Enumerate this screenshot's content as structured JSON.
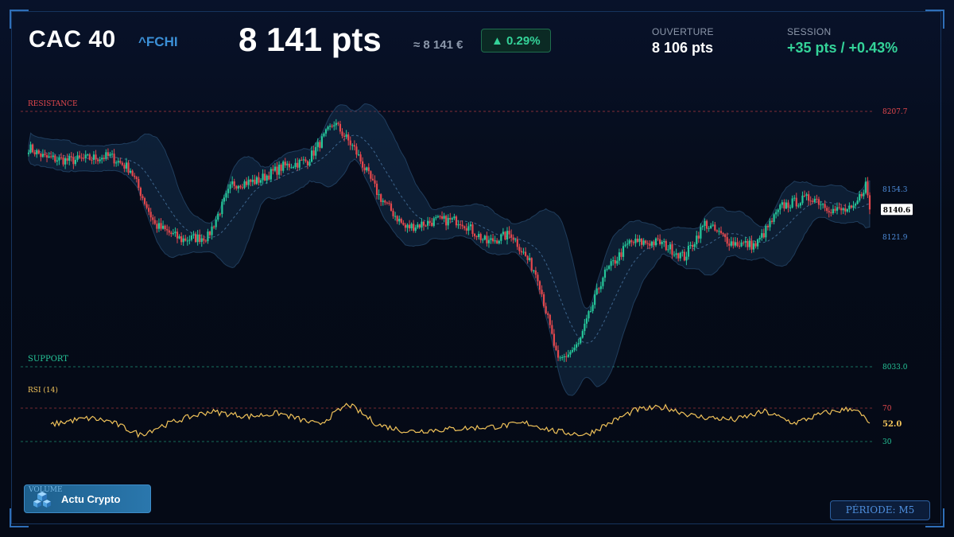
{
  "header": {
    "title": "CAC 40",
    "ticker": "^FCHI",
    "price": "8 141 pts",
    "approx": "≈ 8 141 €",
    "change": "▲ 0.29%",
    "open_label": "OUVERTURE",
    "open_value": "8 106 pts",
    "session_label": "SESSION",
    "session_value": "+35 pts / +0.43%"
  },
  "colors": {
    "up": "#26c79a",
    "down": "#e5484d",
    "resistance": "#e5484d",
    "support": "#26c79a",
    "rsi": "#f1c35a",
    "accent": "#3b8fd6",
    "positive_text": "#34d399"
  },
  "levels": {
    "resistance_label": "RESISTANCE",
    "resistance_value": "8207.7",
    "support_label": "SUPPORT",
    "support_value": "8033.0",
    "band_upper": "8154.3",
    "band_lower": "8121.9",
    "last_price": "8140.6"
  },
  "rsi": {
    "label": "RSI (14)",
    "upper": "70",
    "lower": "30",
    "last": "52.0"
  },
  "footer": {
    "volume_label": "VOLUME",
    "brand": "Actu Crypto",
    "period": "PÉRIODE: M5"
  },
  "chart_data": {
    "type": "candlestick",
    "timeframe": "M5",
    "ylim": [
      8033.0,
      8207.7
    ],
    "close_anchors": [
      [
        0,
        8183
      ],
      [
        8,
        8176
      ],
      [
        20,
        8174
      ],
      [
        40,
        8177
      ],
      [
        50,
        8168
      ],
      [
        62,
        8130
      ],
      [
        75,
        8120
      ],
      [
        88,
        8122
      ],
      [
        100,
        8158
      ],
      [
        112,
        8160
      ],
      [
        125,
        8170
      ],
      [
        137,
        8174
      ],
      [
        150,
        8200
      ],
      [
        160,
        8182
      ],
      [
        172,
        8150
      ],
      [
        185,
        8128
      ],
      [
        200,
        8133
      ],
      [
        212,
        8133
      ],
      [
        225,
        8118
      ],
      [
        237,
        8124
      ],
      [
        250,
        8095
      ],
      [
        260,
        8036
      ],
      [
        270,
        8048
      ],
      [
        282,
        8095
      ],
      [
        295,
        8118
      ],
      [
        310,
        8118
      ],
      [
        322,
        8108
      ],
      [
        332,
        8131
      ],
      [
        345,
        8118
      ],
      [
        357,
        8116
      ],
      [
        370,
        8143
      ],
      [
        385,
        8149
      ],
      [
        395,
        8140
      ],
      [
        405,
        8140
      ],
      [
        411,
        8158
      ],
      [
        413,
        8140.6
      ]
    ],
    "rsi_range": [
      30,
      70
    ],
    "rsi_anchors": [
      [
        0,
        50
      ],
      [
        10,
        55
      ],
      [
        20,
        58
      ],
      [
        30,
        54
      ],
      [
        45,
        38
      ],
      [
        55,
        48
      ],
      [
        65,
        56
      ],
      [
        80,
        66
      ],
      [
        100,
        60
      ],
      [
        115,
        64
      ],
      [
        135,
        50
      ],
      [
        150,
        75
      ],
      [
        165,
        50
      ],
      [
        180,
        42
      ],
      [
        210,
        46
      ],
      [
        225,
        48
      ],
      [
        240,
        52
      ],
      [
        255,
        42
      ],
      [
        270,
        38
      ],
      [
        280,
        50
      ],
      [
        295,
        68
      ],
      [
        310,
        71
      ],
      [
        325,
        60
      ],
      [
        345,
        56
      ],
      [
        360,
        66
      ],
      [
        375,
        52
      ],
      [
        390,
        64
      ],
      [
        405,
        70
      ],
      [
        413,
        52
      ]
    ]
  }
}
